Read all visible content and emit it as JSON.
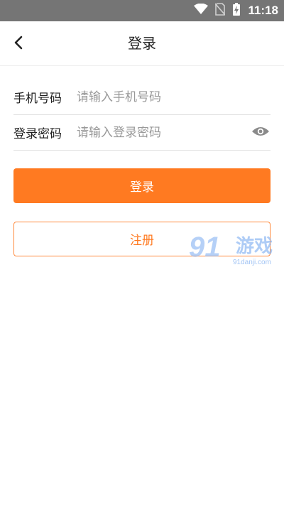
{
  "status_bar": {
    "time": "11:18",
    "icons": [
      "wifi-icon",
      "no-sim-icon",
      "battery-charging-icon"
    ]
  },
  "header": {
    "title": "登录",
    "back_icon": "back-arrow-icon"
  },
  "form": {
    "phone_label": "手机号码",
    "phone_placeholder": "请输入手机号码",
    "password_label": "登录密码",
    "password_placeholder": "请输入登录密码",
    "password_toggle_icon": "eye-icon"
  },
  "buttons": {
    "login_label": "登录",
    "register_label": "注册"
  },
  "watermark": {
    "logo": "91",
    "name": "游戏",
    "url": "91danji.com"
  },
  "colors": {
    "accent": "#ff7a21",
    "status_bar": "#757575",
    "divider": "#e0e0e0",
    "placeholder": "#999999"
  }
}
